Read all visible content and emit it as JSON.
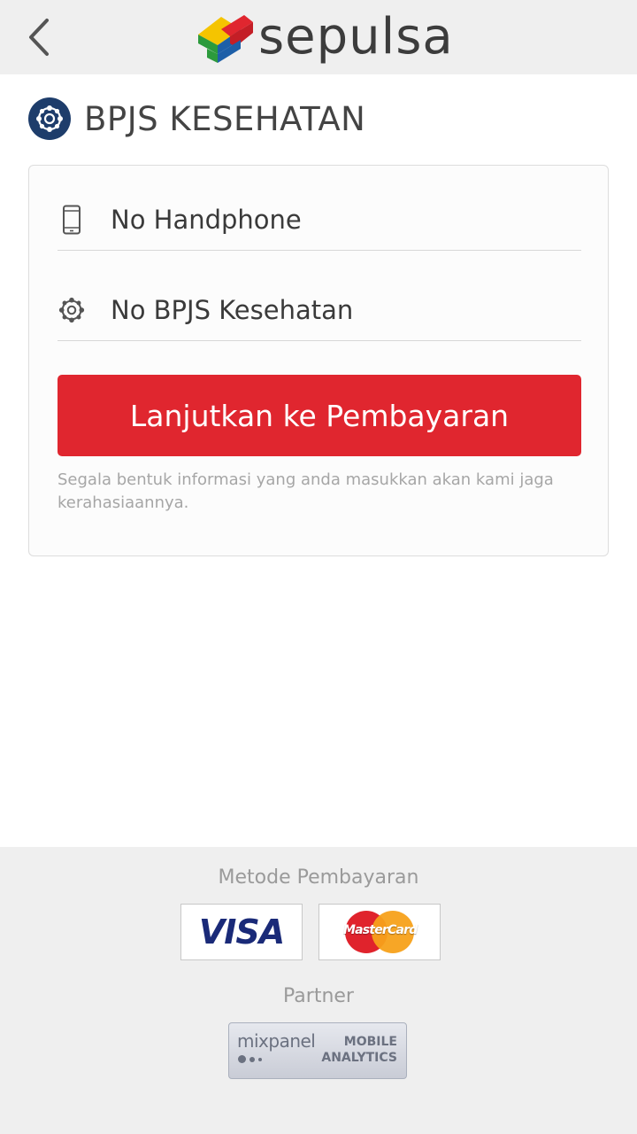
{
  "header": {
    "back_icon": "chevron-left-icon",
    "logo_text": "sepulsa"
  },
  "page": {
    "title": "BPJS KESEHATAN",
    "title_icon": "bpjs-logo-icon"
  },
  "form": {
    "phone_placeholder": "No Handphone",
    "phone_icon": "phone-icon",
    "bpjs_placeholder": "No BPJS Kesehatan",
    "bpjs_icon": "bpjs-icon",
    "submit_label": "Lanjutkan ke Pembayaran",
    "privacy_note": "Segala bentuk informasi yang anda masukkan akan kami jaga kerahasiaannya."
  },
  "footer": {
    "payment_label": "Metode Pembayaran",
    "payment_methods": [
      "VISA",
      "MasterCard"
    ],
    "partner_label": "Partner",
    "partner_name": "mixpanel",
    "partner_tagline_1": "MOBILE",
    "partner_tagline_2": "ANALYTICS"
  },
  "colors": {
    "primary_button": "#e0262f",
    "header_bg": "#efefef",
    "bpjs_blue": "#1e3d6b"
  }
}
